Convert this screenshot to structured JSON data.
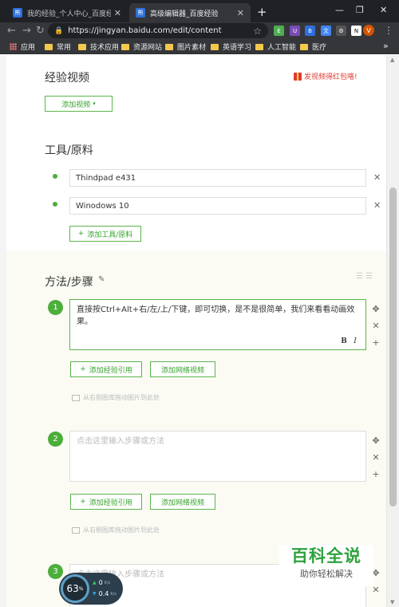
{
  "browser": {
    "tabs": [
      {
        "title": "我的经验_个人中心_百度经验",
        "fav": "熊"
      },
      {
        "title": "高级编辑器_百度经验",
        "fav": "熊"
      }
    ],
    "url": "https://jingyan.baidu.com/edit/content",
    "extensions": [
      {
        "icon": "evernote-icon",
        "color": "#4caf50",
        "char": "E"
      },
      {
        "icon": "library-icon",
        "color": "#7b4bb6",
        "char": "U"
      },
      {
        "icon": "bookmark-icon",
        "color": "#2e6fdb",
        "char": "B"
      },
      {
        "icon": "translate-icon",
        "color": "#4285f4",
        "char": "文"
      },
      {
        "icon": "tools-icon",
        "color": "#555555",
        "char": "⚙"
      },
      {
        "icon": "notion-icon",
        "color": "#ffffff",
        "char": "N"
      }
    ],
    "avatar_letter": "V",
    "bookmarks": [
      "应用",
      "常用",
      "技术应用",
      "资源网站",
      "图片素材",
      "英语学习",
      "人工智能",
      "医疗"
    ]
  },
  "page": {
    "video_section": {
      "title": "经验视频",
      "reward_text": "发视频得红包咯!",
      "add_video_label": "添加视频"
    },
    "tools_section": {
      "title": "工具/原料",
      "items": [
        "Thindpad e431",
        "Winodows 10"
      ],
      "add_tool_label": "添加工具/原料"
    },
    "steps_section": {
      "title": "方法/步骤",
      "steps": [
        {
          "number": "1",
          "text": "直接按Ctrl+Alt+右/左/上/下键，即可切换，是不是很简单，我们来看看动画效果。",
          "placeholder": ""
        },
        {
          "number": "2",
          "text": "",
          "placeholder": "点击这里输入步骤或方法"
        },
        {
          "number": "3",
          "text": "",
          "placeholder": "点击这里输入步骤或方法"
        }
      ],
      "add_ref_label": "添加经验引用",
      "add_video_label": "添加网络视频",
      "drag_hint": "从右侧图库拖动图片到此处",
      "bold_label": "B",
      "italic_label": "I"
    }
  },
  "watermark": {
    "big": "百科全说",
    "small": "助你轻松解决"
  },
  "speed_widget": {
    "percent": "63",
    "percent_unit": "%",
    "up_rate": "0",
    "up_unit": "K/s",
    "down_rate": "0.4",
    "down_unit": "K/s"
  }
}
